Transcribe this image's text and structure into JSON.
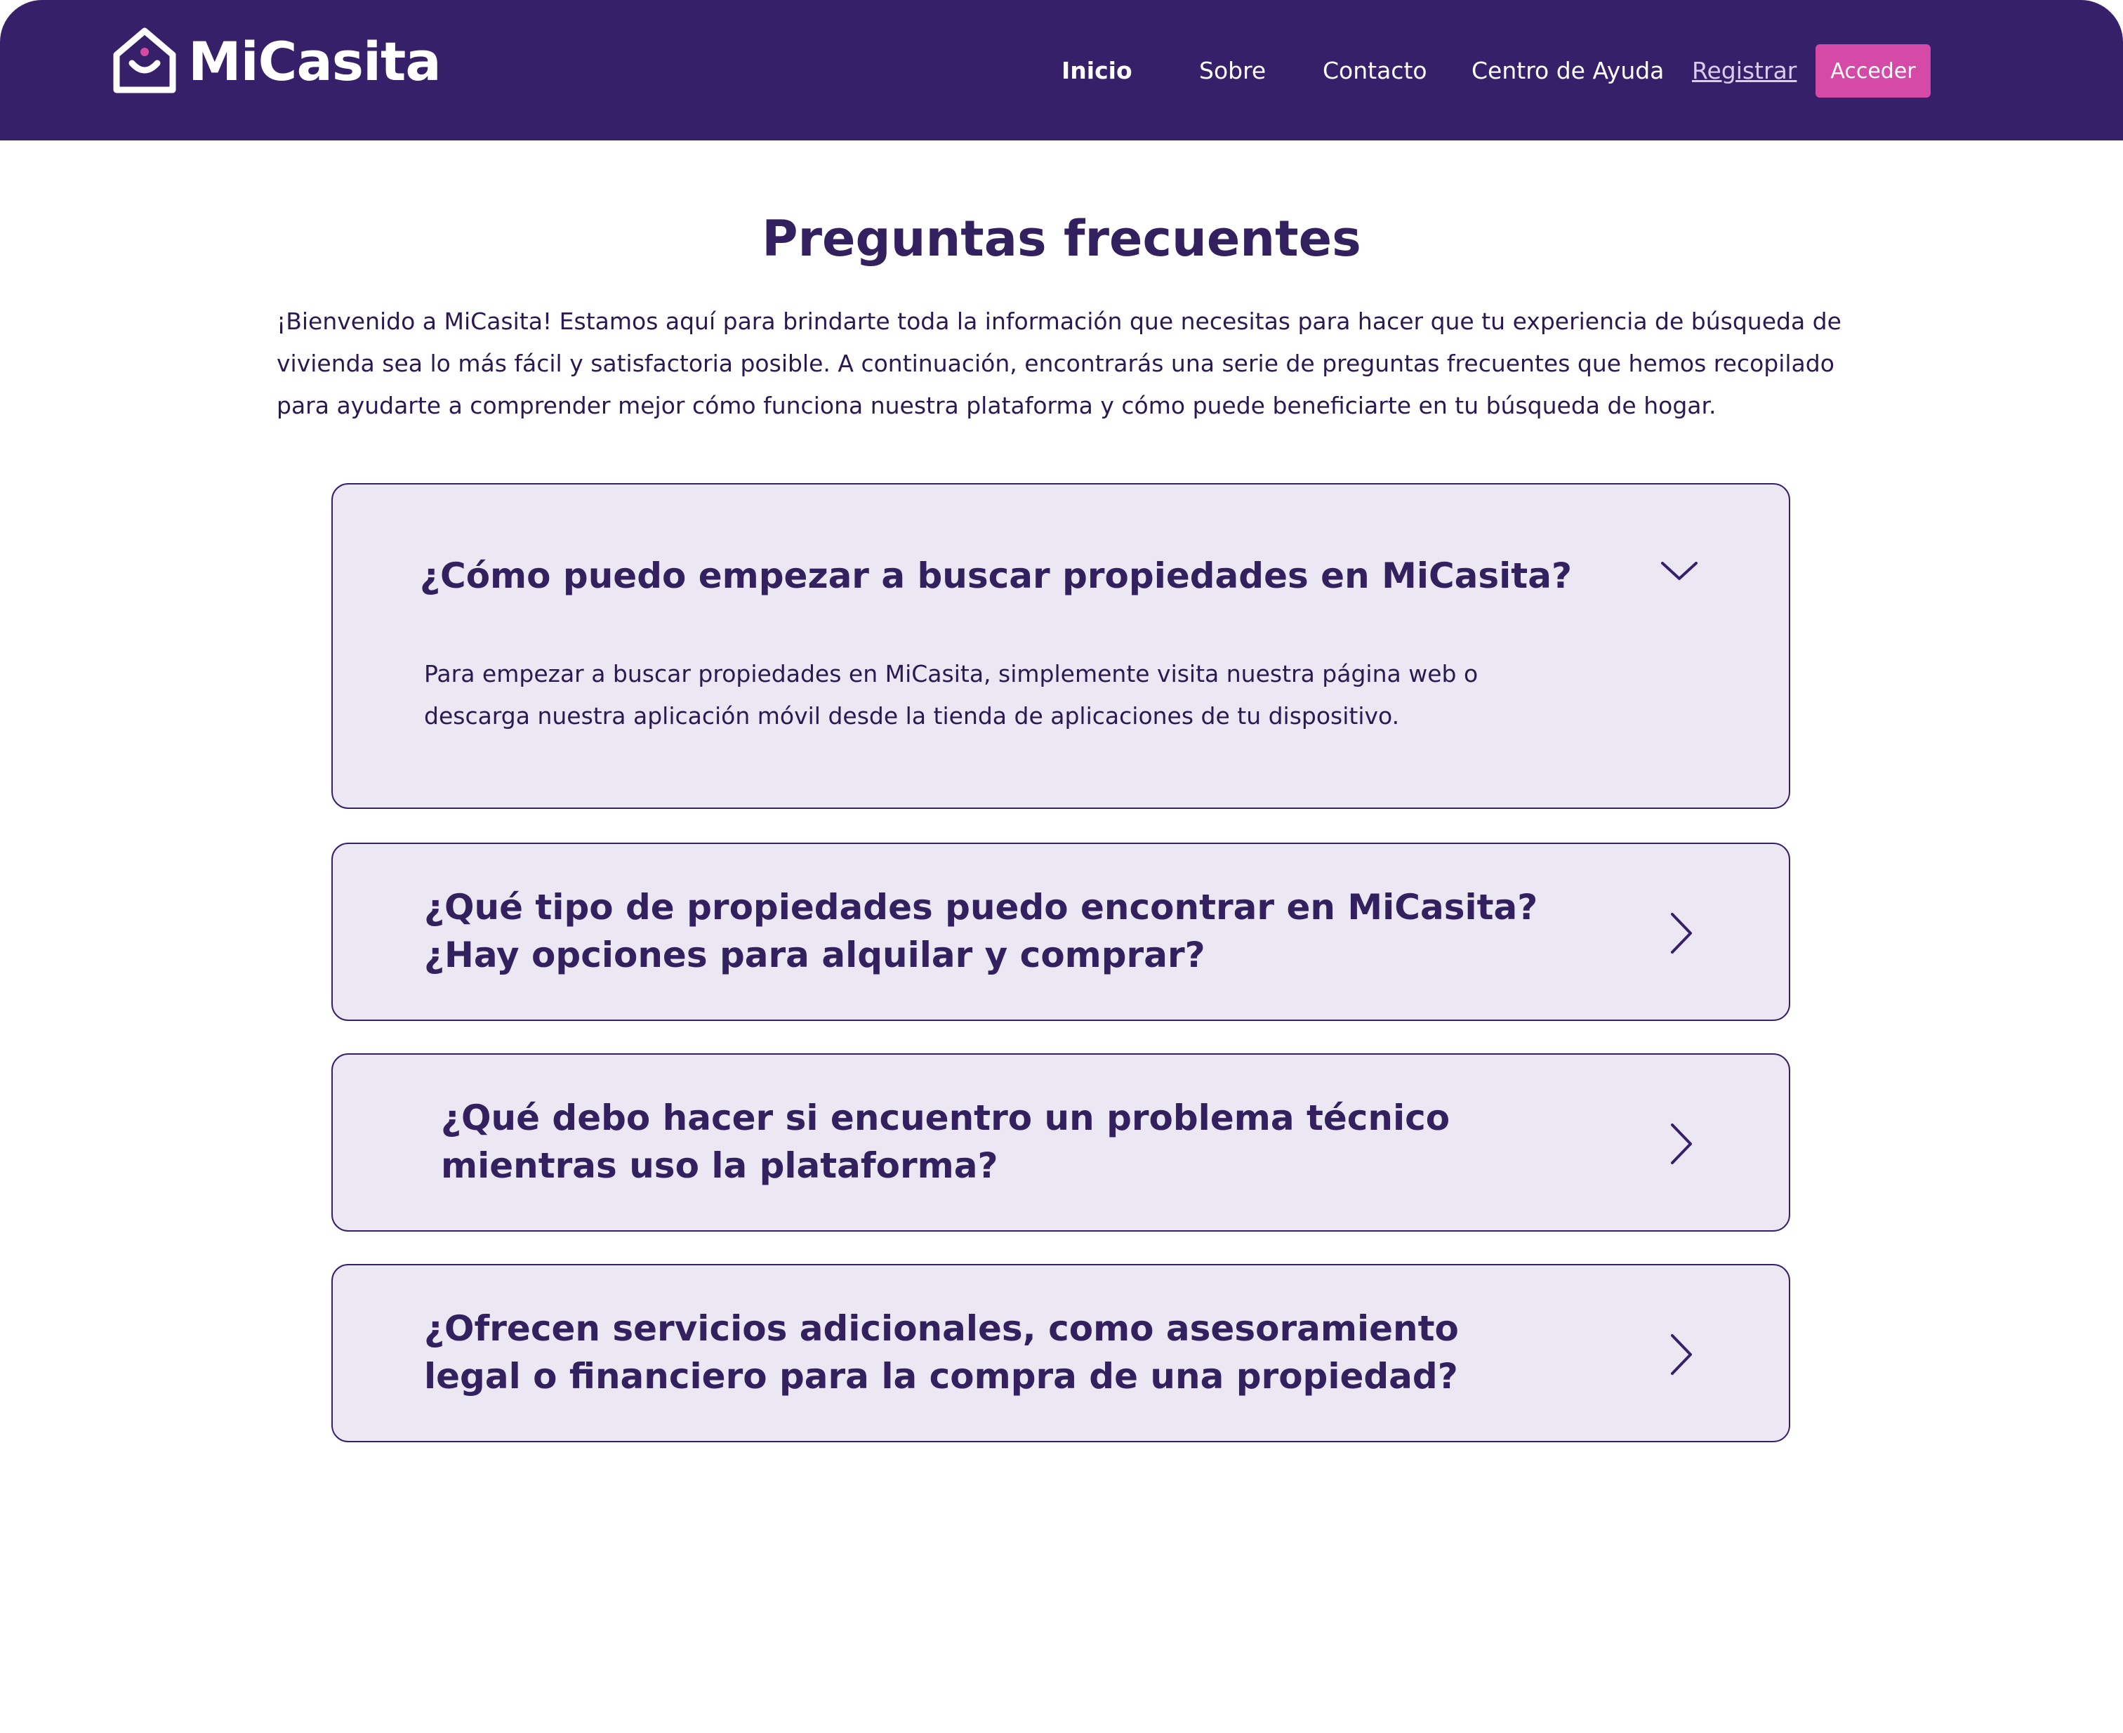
{
  "brand": {
    "name": "MiCasita"
  },
  "nav": {
    "items": [
      "Inicio",
      "Sobre",
      "Contacto",
      "Centro de Ayuda"
    ],
    "register": "Registrar",
    "login": "Acceder"
  },
  "page": {
    "title": "Preguntas frecuentes",
    "intro": "¡Bienvenido a MiCasita! Estamos aquí para brindarte toda la información que necesitas para hacer que tu experiencia de búsqueda de vivienda sea lo más fácil y satisfactoria posible. A continuación, encontrarás una serie de preguntas frecuentes que hemos recopilado para ayudarte a comprender mejor cómo funciona nuestra plataforma y cómo puede beneficiarte en tu búsqueda de hogar."
  },
  "faq": [
    {
      "question": "¿Cómo puedo empezar a buscar propiedades en MiCasita?",
      "answer": "Para empezar a buscar propiedades en MiCasita, simplemente visita nuestra página web o descarga nuestra aplicación móvil desde la tienda de aplicaciones de tu dispositivo.",
      "expanded": true
    },
    {
      "question": "¿Qué tipo de propiedades puedo encontrar en MiCasita? ¿Hay opciones para alquilar y comprar?",
      "expanded": false
    },
    {
      "question": "¿Qué debo hacer si encuentro un problema técnico mientras uso la plataforma?",
      "expanded": false
    },
    {
      "question": "¿Ofrecen servicios adicionales, como asesoramiento legal o financiero para la compra de una propiedad?",
      "expanded": false
    }
  ],
  "icons": {
    "logo": "house-smile-icon",
    "expanded": "chevron-down-icon",
    "collapsed": "chevron-right-icon"
  },
  "colors": {
    "primary": "#36206a",
    "accent": "#d54aa6",
    "card_bg": "#ebe7f3",
    "text": "#33205f",
    "white": "#ffffff"
  }
}
